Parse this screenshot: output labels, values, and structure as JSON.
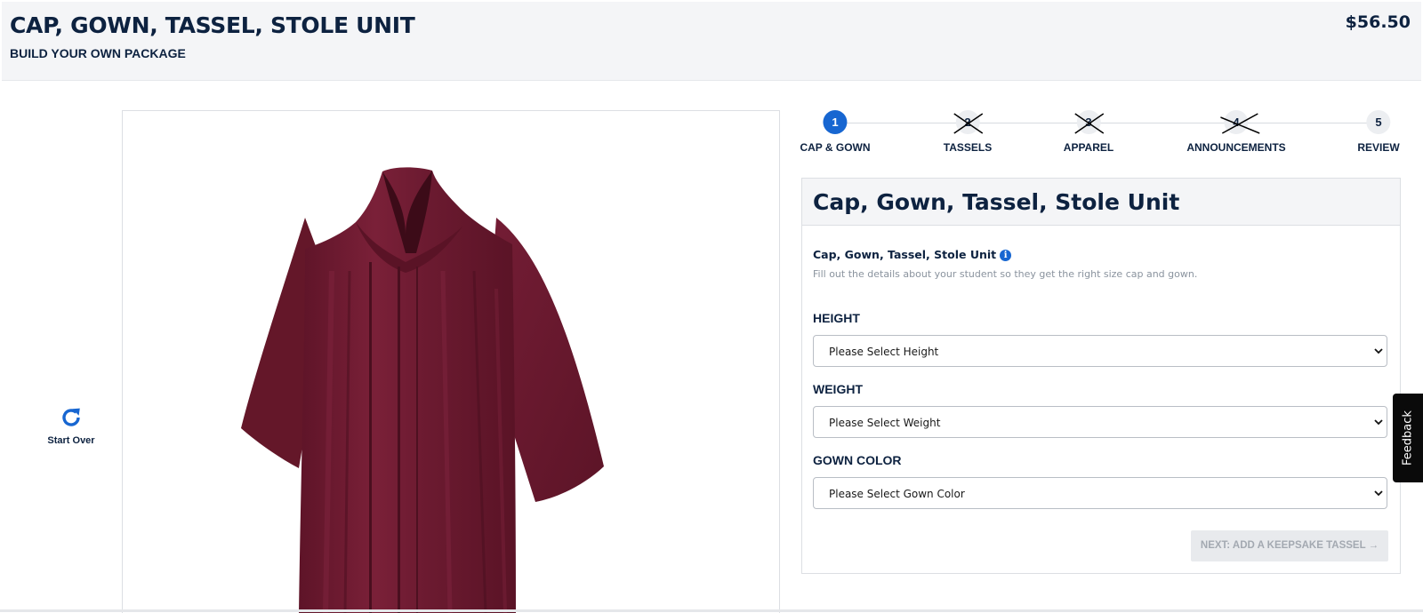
{
  "header": {
    "title": "CAP, GOWN, TASSEL, STOLE UNIT",
    "subtitle": "BUILD YOUR OWN PACKAGE",
    "price": "$56.50"
  },
  "start_over": {
    "label": "Start Over",
    "icon": "refresh-icon"
  },
  "product_image": {
    "subject": "maroon-graduation-gown",
    "color": "#6e1a30"
  },
  "stepper": {
    "steps": [
      {
        "number": "1",
        "label": "CAP & GOWN",
        "state": "active"
      },
      {
        "number": "2",
        "label": "TASSELS",
        "state": "crossed"
      },
      {
        "number": "3",
        "label": "APPAREL",
        "state": "crossed"
      },
      {
        "number": "4",
        "label": "ANNOUNCEMENTS",
        "state": "crossed"
      },
      {
        "number": "5",
        "label": "REVIEW",
        "state": "default"
      }
    ]
  },
  "form": {
    "title": "Cap, Gown, Tassel, Stole Unit",
    "product_name": "Cap, Gown, Tassel, Stole Unit",
    "info_icon": "info-icon",
    "description": "Fill out the details about your student so they get the right size cap and gown.",
    "fields": {
      "height": {
        "label": "HEIGHT",
        "value": "Please Select Height"
      },
      "weight": {
        "label": "WEIGHT",
        "value": "Please Select Weight"
      },
      "gown_color": {
        "label": "GOWN COLOR",
        "value": "Please Select Gown Color"
      }
    },
    "next_button": "NEXT: ADD A KEEPSAKE TASSEL →"
  },
  "feedback": {
    "label": "Feedback"
  },
  "colors": {
    "accent": "#1766d1",
    "navy": "#0d2240",
    "gown": "#6e1a30",
    "header_bg": "#f4f5f7"
  }
}
